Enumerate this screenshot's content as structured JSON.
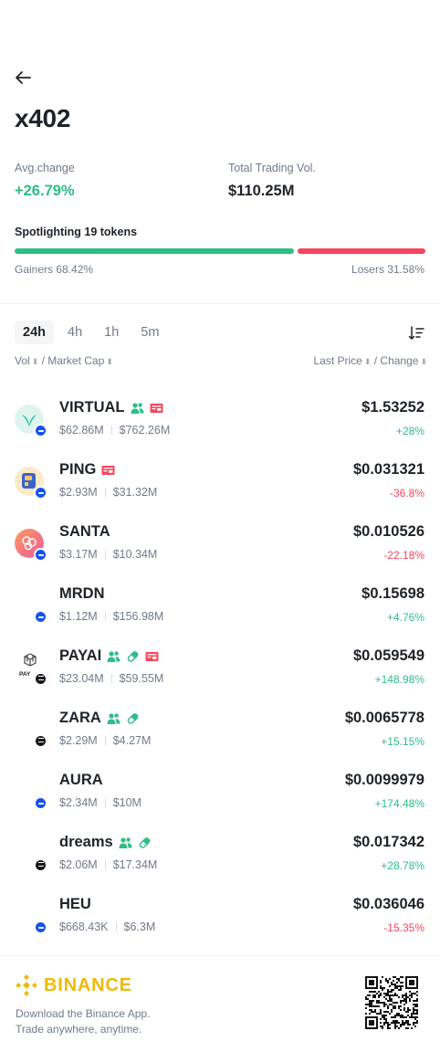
{
  "page": {
    "title": "x402"
  },
  "stats": {
    "avg_label": "Avg.change",
    "avg_value": "+26.79%",
    "vol_label": "Total Trading Vol.",
    "vol_value": "$110.25M"
  },
  "spotlight": {
    "text": "Spotlighting 19 tokens",
    "gainers_label": "Gainers 68.42%",
    "losers_label": "Losers 31.58%",
    "gainers_fraction": 0.6842,
    "colors": {
      "up": "#2ebd85",
      "down": "#f6465d"
    }
  },
  "tabs": [
    "24h",
    "4h",
    "1h",
    "5m"
  ],
  "active_tab": "24h",
  "columns": {
    "vol": "Vol",
    "slash": " / ",
    "mcap": "Market Cap",
    "last_price": "Last Price",
    "change": "Change"
  },
  "tokens": [
    {
      "symbol": "VIRTUAL",
      "vol": "$62.86M",
      "mcap": "$762.26M",
      "price": "$1.53252",
      "change": "+28%",
      "direction": "up",
      "chain": "base",
      "logo": "virtual-logo",
      "badges": [
        "users",
        "ticket"
      ]
    },
    {
      "symbol": "PING",
      "vol": "$2.93M",
      "mcap": "$31.32M",
      "price": "$0.031321",
      "change": "-36.8%",
      "direction": "down",
      "chain": "base",
      "logo": "ping-logo",
      "badges": [
        "ticket"
      ]
    },
    {
      "symbol": "SANTA",
      "vol": "$3.17M",
      "mcap": "$10.34M",
      "price": "$0.010526",
      "change": "-22.18%",
      "direction": "down",
      "chain": "base",
      "logo": "santa-logo",
      "badges": []
    },
    {
      "symbol": "MRDN",
      "vol": "$1.12M",
      "mcap": "$156.98M",
      "price": "$0.15698",
      "change": "+4.76%",
      "direction": "up",
      "chain": "base",
      "logo": "",
      "badges": []
    },
    {
      "symbol": "PAYAI",
      "vol": "$23.04M",
      "mcap": "$59.55M",
      "price": "$0.059549",
      "change": "+148.98%",
      "direction": "up",
      "chain": "solana",
      "logo": "payai-logo",
      "badges": [
        "users",
        "pill",
        "ticket"
      ]
    },
    {
      "symbol": "ZARA",
      "vol": "$2.29M",
      "mcap": "$4.27M",
      "price": "$0.0065778",
      "change": "+15.15%",
      "direction": "up",
      "chain": "solana",
      "logo": "",
      "badges": [
        "users",
        "pill"
      ]
    },
    {
      "symbol": "AURA",
      "vol": "$2.34M",
      "mcap": "$10M",
      "price": "$0.0099979",
      "change": "+174.48%",
      "direction": "up",
      "chain": "base",
      "logo": "",
      "badges": []
    },
    {
      "symbol": "dreams",
      "vol": "$2.06M",
      "mcap": "$17.34M",
      "price": "$0.017342",
      "change": "+28.78%",
      "direction": "up",
      "chain": "solana",
      "logo": "",
      "badges": [
        "users",
        "pill"
      ]
    },
    {
      "symbol": "HEU",
      "vol": "$668.43K",
      "mcap": "$6.3M",
      "price": "$0.036046",
      "change": "-15.35%",
      "direction": "down",
      "chain": "base",
      "logo": "",
      "badges": []
    }
  ],
  "footer": {
    "brand": "BINANCE",
    "line1": "Download the Binance App.",
    "line2": "Trade anywhere, anytime.",
    "brand_color": "#f0b90b"
  }
}
